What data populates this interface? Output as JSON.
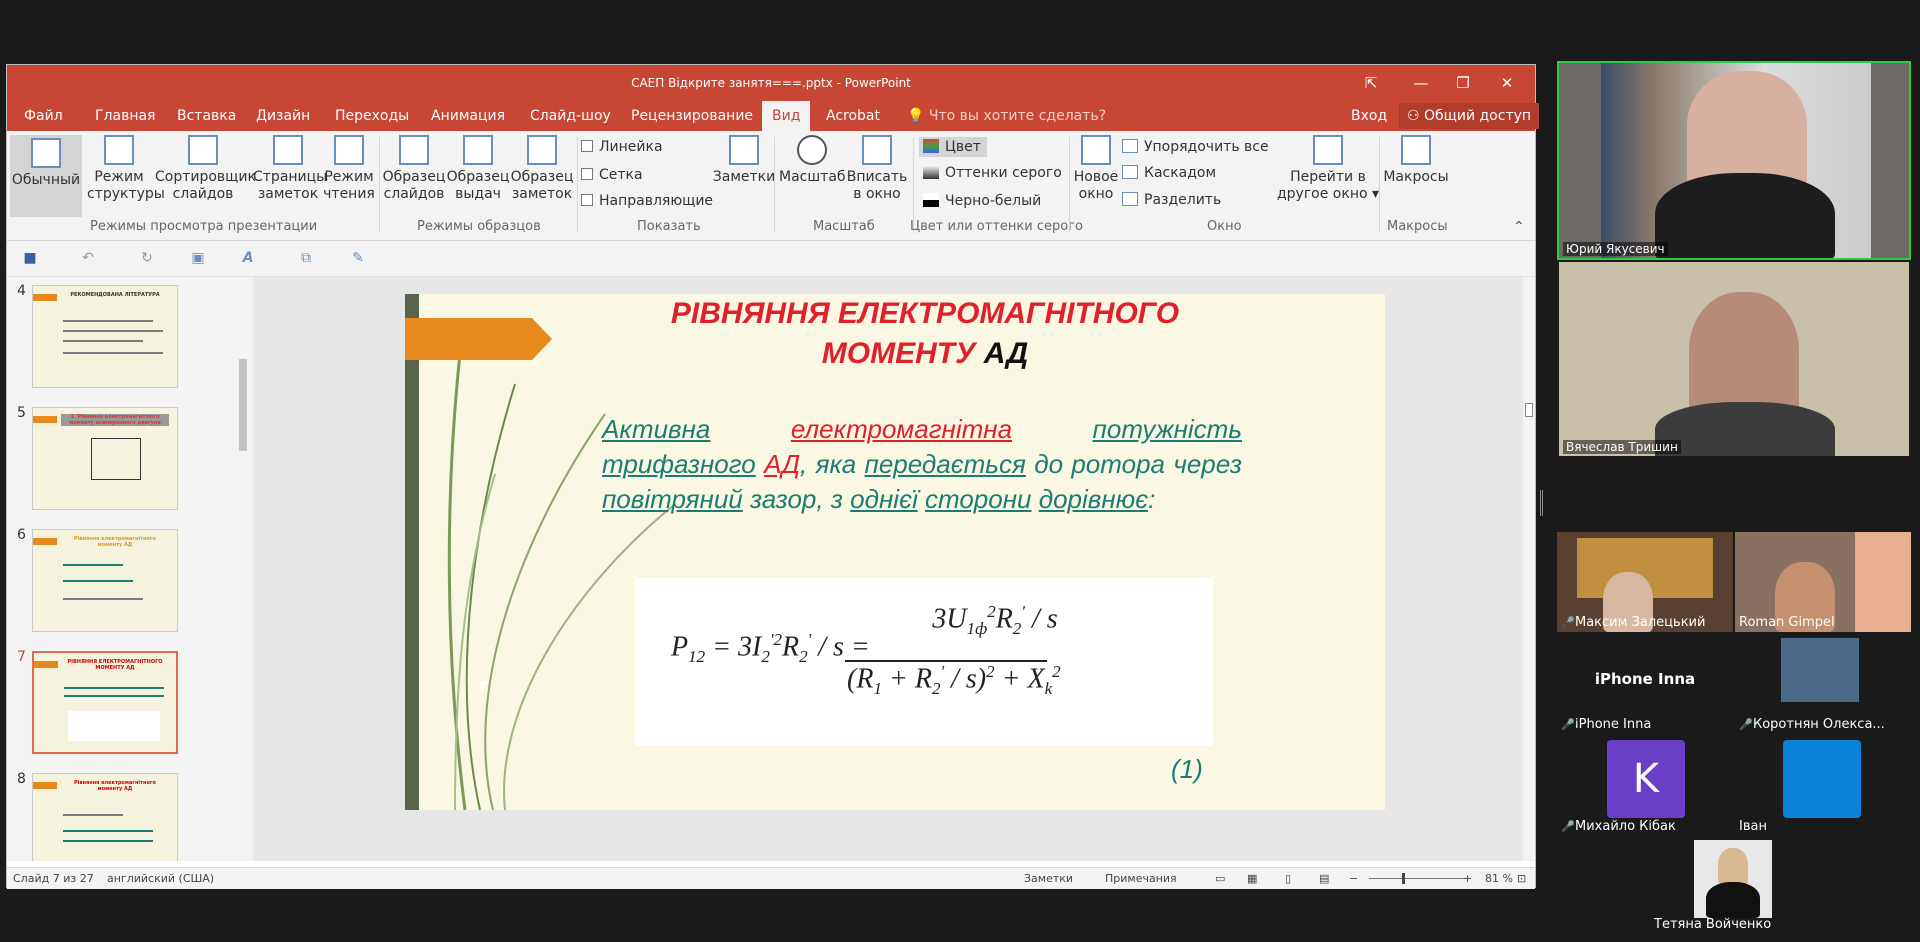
{
  "window": {
    "title": "САЕП Відкрите занятя===.pptx - PowerPoint"
  },
  "tabs": [
    "Файл",
    "Главная",
    "Вставка",
    "Дизайн",
    "Переходы",
    "Анимация",
    "Слайд-шоу",
    "Рецензирование",
    "Вид",
    "Acrobat"
  ],
  "active_tab": "Вид",
  "tell_me": "Что вы хотите сделать?",
  "sign_in": "Вход",
  "share": "Общий доступ",
  "ribbon": {
    "views": {
      "normal": "Обычный",
      "outline_1": "Режим",
      "outline_2": "структуры",
      "sorter_1": "Сортировщик",
      "sorter_2": "слайдов",
      "notes_1": "Страницы",
      "notes_2": "заметок",
      "reading_1": "Режим",
      "reading_2": "чтения",
      "group": "Режимы просмотра презентации"
    },
    "masters": {
      "slide_1": "Образец",
      "slide_2": "слайдов",
      "handout_1": "Образец",
      "handout_2": "выдач",
      "notes_1": "Образец",
      "notes_2": "заметок",
      "group": "Режимы образцов"
    },
    "show": {
      "ruler": "Линейка",
      "grid": "Сетка",
      "guides": "Направляющие",
      "notes": "Заметки",
      "group": "Показать"
    },
    "zoom": {
      "zoom": "Масштаб",
      "fit_1": "Вписать",
      "fit_2": "в окно",
      "group": "Масштаб"
    },
    "color": {
      "color": "Цвет",
      "gray": "Оттенки серого",
      "bw": "Черно-белый",
      "group": "Цвет или оттенки серого"
    },
    "window": {
      "new_1": "Новое",
      "new_2": "окно",
      "arrange": "Упорядочить все",
      "cascade": "Каскадом",
      "split": "Разделить",
      "switch_1": "Перейти в",
      "switch_2": "другое окно",
      "group": "Окно"
    },
    "macros": {
      "macros": "Макросы",
      "group": "Макросы"
    }
  },
  "thumbnails": [
    {
      "num": "4",
      "title": "РЕКОМЕНДОВАНА ЛІТЕРАТУРА"
    },
    {
      "num": "5",
      "title": "1. Рівняння електромагнітного моменту асинхронного двигуна"
    },
    {
      "num": "6",
      "title": "Рівняння електромагнітного моменту АД"
    },
    {
      "num": "7",
      "title": "РІВНЯННЯ ЕЛЕКТРОМАГНІТНОГО МОМЕНТУ АД"
    },
    {
      "num": "8",
      "title": "Рівняння електромагнітного моменту АД"
    }
  ],
  "current_slide": "7",
  "slide": {
    "title_red_1": "РІВНЯННЯ ЕЛЕКТРОМАГНІТНОГО",
    "title_red_2": "МОМЕНТУ ",
    "title_black": "АД",
    "body": {
      "w1": "Активна",
      "w2": "електромагнітна",
      "w3": "потужність",
      "w4": "трифазного",
      "w5": "АД",
      "w6": ", яка ",
      "w7": "передається",
      "w8": " до ротора",
      "w9": "через ",
      "w10": "повітряний",
      "w11": " зазор, з ",
      "w12": "однієї",
      "w13": " ",
      "w14": "сторони",
      "w15": "дорівнює",
      "w16": ":"
    },
    "formula_lhs": "P",
    "formula_number": "(1)"
  },
  "status": {
    "slide_count": "Слайд 7 из 27",
    "language": "английский (США)",
    "notes": "Заметки",
    "comments": "Примечания",
    "zoom": "81 %"
  },
  "participants": [
    {
      "name": "Юрий Якусевич",
      "speaking": true
    },
    {
      "name": "Вячеслав Тришин",
      "speaking": false
    },
    {
      "name": "Максим Залецький",
      "muted": true
    },
    {
      "name": "Roman Gimpel",
      "muted": false
    },
    {
      "name": "iPhone Inna",
      "muted": true,
      "center_label": "iPhone Inna"
    },
    {
      "name": "Коротнян Олекса...",
      "muted": true
    },
    {
      "name": "Михайло Кібак",
      "muted": true,
      "initial": "K"
    },
    {
      "name": "Іван",
      "muted": false
    },
    {
      "name": "Тетяна Войченко",
      "muted": false
    }
  ],
  "colors": {
    "accent": "#c74634",
    "slide_title": "#e0202a",
    "slide_text": "#1c7d74",
    "speaker_border": "#2ecc40"
  }
}
